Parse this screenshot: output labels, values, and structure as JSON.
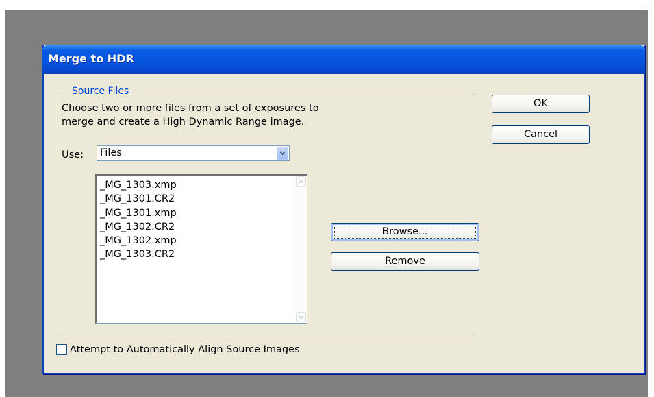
{
  "dialog": {
    "title": "Merge to HDR",
    "source_files": {
      "legend": "Source Files",
      "description_line1": "Choose two or more files from a set of exposures to",
      "description_line2": "merge and create a High Dynamic Range image.",
      "use_label": "Use:",
      "use_value": "Files",
      "files": [
        "_MG_1303.xmp",
        "_MG_1301.CR2",
        "_MG_1301.xmp",
        "_MG_1302.CR2",
        "_MG_1302.xmp",
        "_MG_1303.CR2"
      ],
      "browse_label": "Browse...",
      "remove_label": "Remove"
    },
    "ok_label": "OK",
    "cancel_label": "Cancel",
    "align_checkbox_label": "Attempt to Automatically Align Source Images",
    "align_checked": false
  },
  "colors": {
    "titlebar": "#0553dd",
    "dialog_bg": "#ece9d8",
    "legend_text": "#0046d5",
    "backdrop": "#7f7f7f"
  },
  "icons": {
    "combo_arrow": "chevron-down-icon",
    "scroll_up": "scroll-up-arrow-icon",
    "scroll_down": "scroll-down-arrow-icon"
  }
}
